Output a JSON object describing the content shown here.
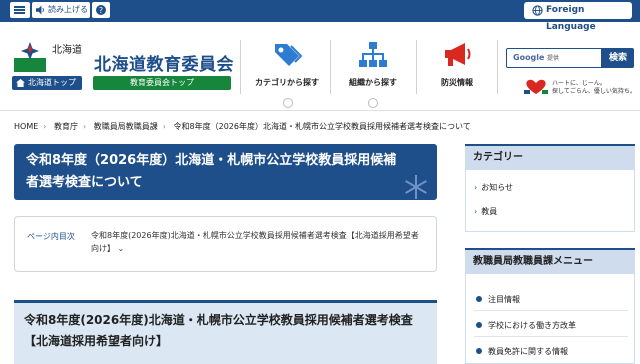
{
  "topbar": {
    "read_aloud_label": "読み上げる",
    "foreign_language_label": "Foreign Language"
  },
  "header": {
    "prefecture_text": "北海道",
    "prefecture_top_label": "北海道トップ",
    "board_title": "北海道教育委員会",
    "board_top_label": "教育委員会トップ",
    "nav": [
      {
        "label": "カテゴリから探す",
        "icon": "tag-icon"
      },
      {
        "label": "組織から探す",
        "icon": "org-chart-icon"
      },
      {
        "label": "防災情報",
        "icon": "megaphone-icon"
      }
    ],
    "search": {
      "google_text": "Google",
      "suffix_text": "提供",
      "button_label": "検索"
    },
    "heart_text_line1": "ハートに、じーん。",
    "heart_text_line2": "探してごらん、優しい気持ち。"
  },
  "breadcrumb": [
    "HOME",
    "教育庁",
    "教職員局教職員課",
    "令和8年度（2026年度）北海道・札幌市公立学校教員採用候補者選考検査について"
  ],
  "main": {
    "page_title": "令和8年度（2026年度）北海道・札幌市公立学校教員採用候補者選考検査について",
    "toc_label": "ページ内目次",
    "toc_link": "令和8年度(2026年度)北海道・札幌市公立学校教員採用候補者選考検査【北海道採用希望者向け】",
    "section_title": "令和8年度(2026年度)北海道・札幌市公立学校教員採用候補者選考検査【北海道採用希望者向け】"
  },
  "sidebar": {
    "category_title": "カテゴリー",
    "category_items": [
      "お知らせ",
      "教員"
    ],
    "menu_title": "教職員局教職員課メニュー",
    "menu_items": [
      "注目情報",
      "学校における働き方改革",
      "教員免許に関する情報"
    ]
  },
  "colors": {
    "brand_blue": "#1e4f8a",
    "brand_green": "#16863c",
    "alert_red": "#d9281f"
  }
}
